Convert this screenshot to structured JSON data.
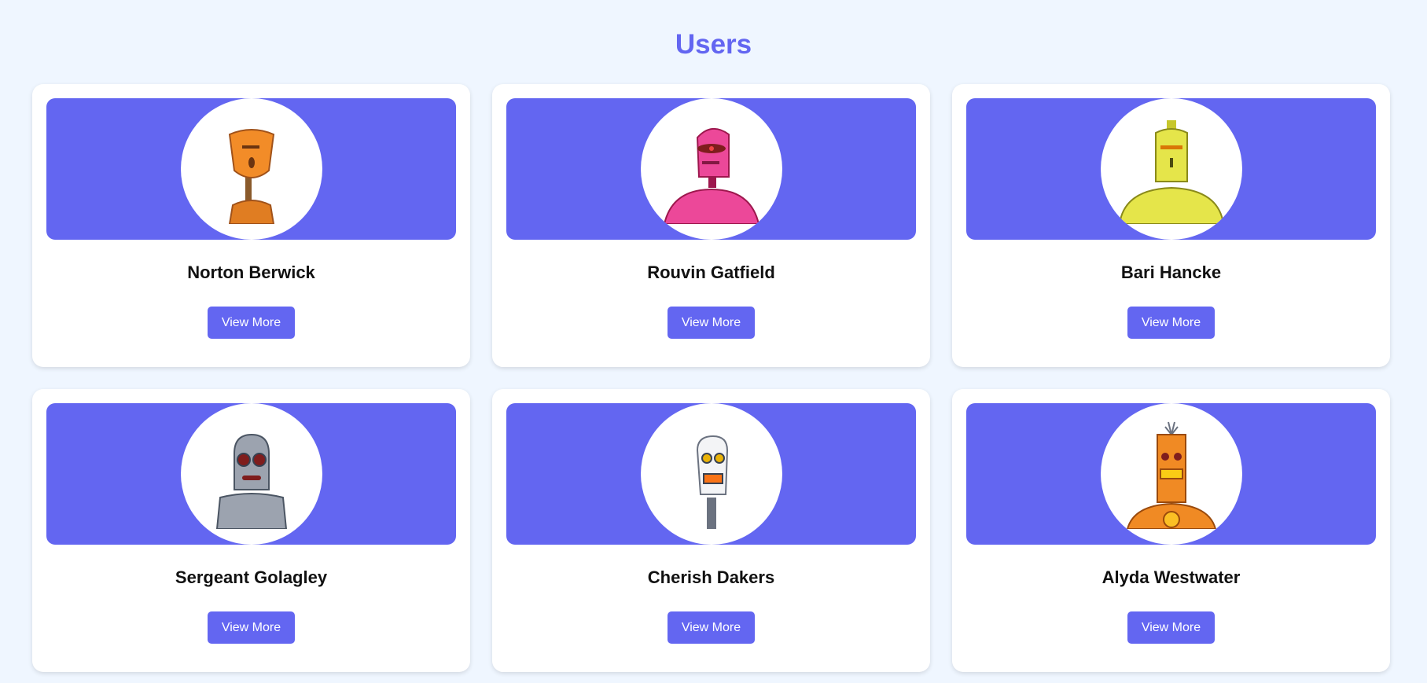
{
  "page": {
    "title": "Users"
  },
  "theme": {
    "accent": "#6366f1",
    "background": "#eff6ff",
    "card": "#ffffff"
  },
  "users": [
    {
      "name": "Norton Berwick",
      "button_label": "View More",
      "avatar_icon": "orange-robot-avatar-icon",
      "avatar_color": "#f28c28"
    },
    {
      "name": "Rouvin Gatfield",
      "button_label": "View More",
      "avatar_icon": "pink-robot-avatar-icon",
      "avatar_color": "#ec4899"
    },
    {
      "name": "Bari Hancke",
      "button_label": "View More",
      "avatar_icon": "yellow-robot-avatar-icon",
      "avatar_color": "#e5e54a"
    },
    {
      "name": "Sergeant Golagley",
      "button_label": "View More",
      "avatar_icon": "gray-robot-avatar-icon",
      "avatar_color": "#9ca3af"
    },
    {
      "name": "Cherish Dakers",
      "button_label": "View More",
      "avatar_icon": "white-robot-avatar-icon",
      "avatar_color": "#f3f4f6"
    },
    {
      "name": "Alyda Westwater",
      "button_label": "View More",
      "avatar_icon": "orange-tall-robot-avatar-icon",
      "avatar_color": "#f08a24"
    }
  ]
}
